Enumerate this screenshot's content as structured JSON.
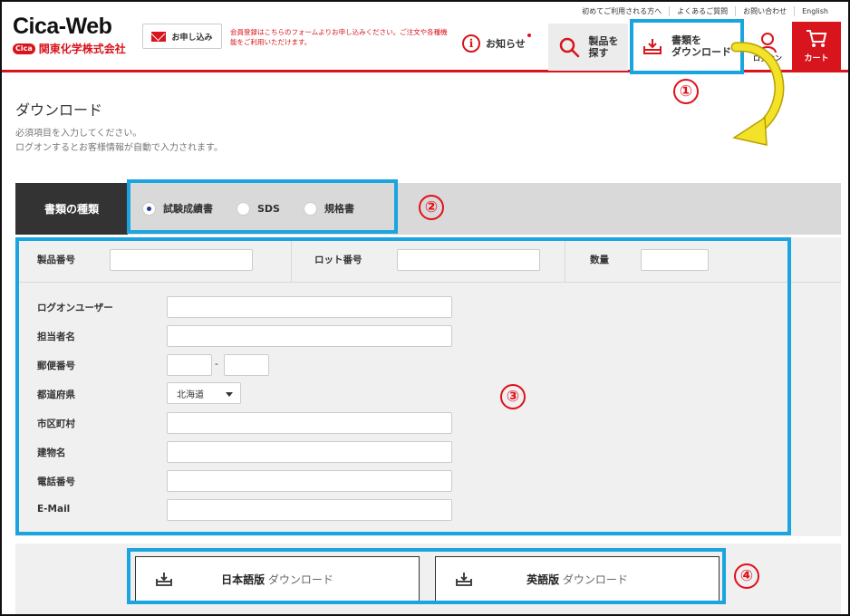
{
  "header": {
    "logo_title": "Cica-Web",
    "logo_badge": "Cica",
    "logo_company": "関東化学株式会社",
    "apply_button": "お申し込み",
    "apply_note": "会員登録はこちらのフォームよりお申し込みください。ご注文や各種機能をご利用いただけます。",
    "top_links": [
      "初めてご利用される方へ",
      "よくあるご質問",
      "お問い合わせ",
      "English"
    ],
    "news": "お知らせ",
    "nav_search_label": "製品を\n探す",
    "nav_download_label": "書類を\nダウンロード",
    "nav_logon_label": "ログオン",
    "nav_cart_label": "カート"
  },
  "annotations": {
    "one": "①",
    "two": "②",
    "three": "③",
    "four": "④",
    "highlight_color": "#1aa4e0",
    "number_color": "#e0101a",
    "arrow_color": "#f0dc1e"
  },
  "page": {
    "title": "ダウンロード",
    "desc_line1": "必須項目を入力してください。",
    "desc_line2": "ログオンするとお客様情報が自動で入力されます。"
  },
  "doc_type": {
    "label": "書類の種類",
    "options": [
      "試験成績書",
      "SDS",
      "規格書"
    ],
    "selected": "試験成績書"
  },
  "form": {
    "product_no": "製品番号",
    "lot_no": "ロット番号",
    "quantity": "数量",
    "logon_user": "ログオンユーザー",
    "person": "担当者名",
    "postal": "郵便番号",
    "postal_sep": "-",
    "prefecture": "都道府県",
    "prefecture_value": "北海道",
    "city": "市区町村",
    "building": "建物名",
    "phone": "電話番号",
    "email": "E-Mail"
  },
  "download": {
    "jp_bold": "日本語版",
    "jp_sub": " ダウンロード",
    "en_bold": "英語版",
    "en_sub": " ダウンロード"
  },
  "colors": {
    "brand_red": "#d8141c",
    "dark_label": "#333333"
  }
}
